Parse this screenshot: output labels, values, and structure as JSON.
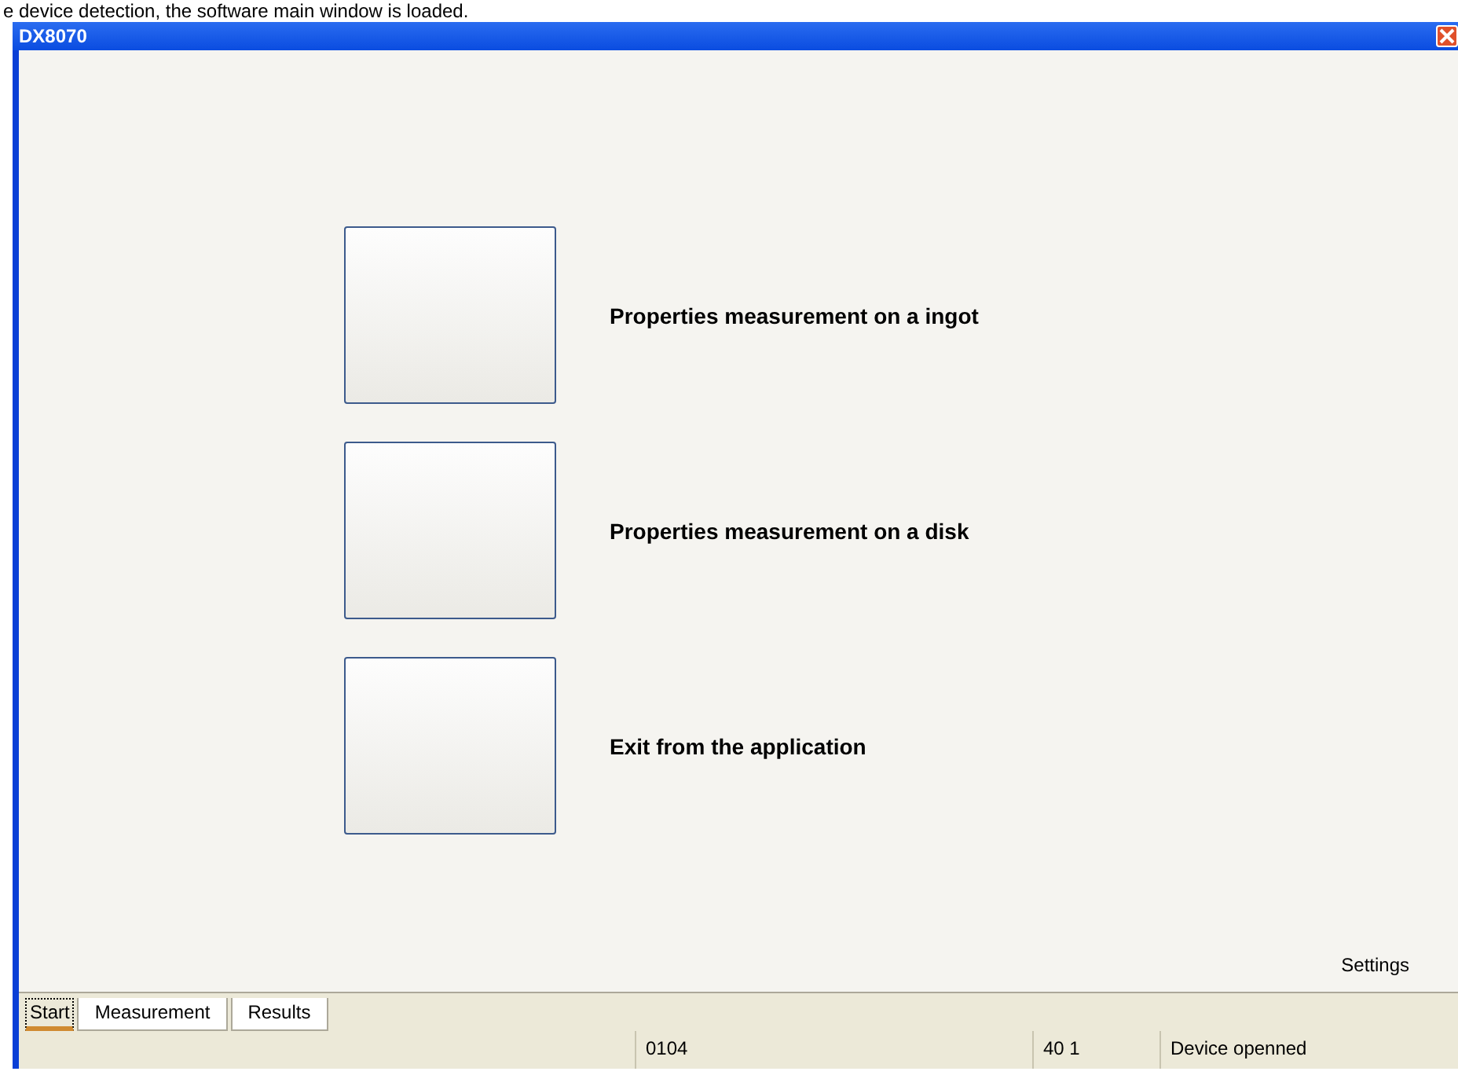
{
  "caption": "e device detection, the software main window is loaded.",
  "window": {
    "title": "DX8070"
  },
  "actions": [
    {
      "label": "Properties measurement on a ingot"
    },
    {
      "label": "Properties measurement on a disk"
    },
    {
      "label": "Exit from the application"
    }
  ],
  "settings_link": "Settings",
  "tabs": [
    {
      "label": "Start",
      "selected": true
    },
    {
      "label": "Measurement",
      "selected": false
    },
    {
      "label": "Results",
      "selected": false
    }
  ],
  "status_bar": [
    "0104",
    "40 1",
    "Device openned"
  ]
}
